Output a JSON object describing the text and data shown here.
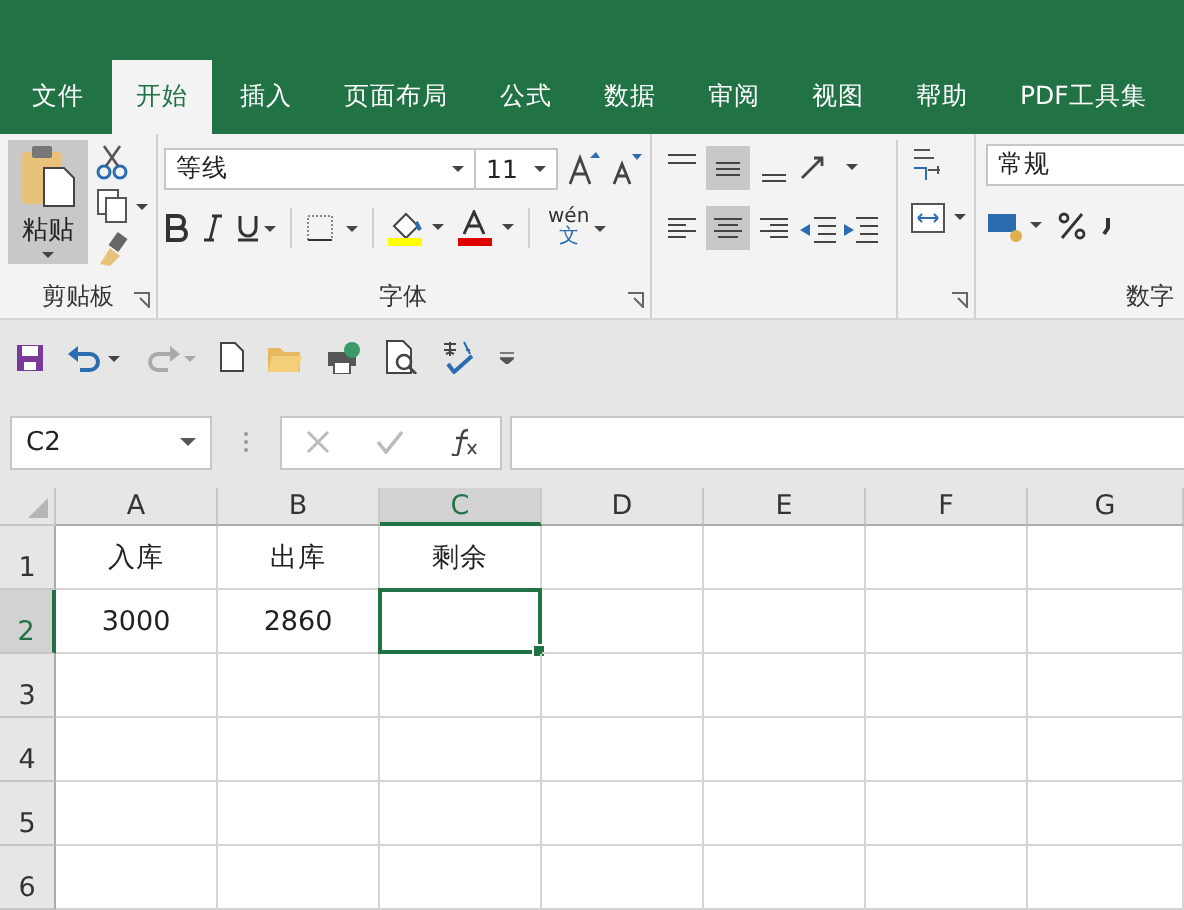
{
  "tabs": [
    {
      "label": "文件",
      "selected": false
    },
    {
      "label": "开始",
      "selected": true
    },
    {
      "label": "插入",
      "selected": false
    },
    {
      "label": "页面布局",
      "selected": false
    },
    {
      "label": "公式",
      "selected": false
    },
    {
      "label": "数据",
      "selected": false
    },
    {
      "label": "审阅",
      "selected": false
    },
    {
      "label": "视图",
      "selected": false
    },
    {
      "label": "帮助",
      "selected": false
    },
    {
      "label": "PDF工具集",
      "selected": false
    }
  ],
  "ribbon": {
    "clipboard": {
      "paste_label": "粘贴",
      "label": "剪贴板"
    },
    "font": {
      "name": "等线",
      "size": "11",
      "phonetic_label": "wén",
      "phonetic_glyph": "文",
      "label": "字体"
    },
    "alignment": {
      "top_row": [
        {
          "kind": "top",
          "selected": false
        },
        {
          "kind": "middle",
          "selected": true
        },
        {
          "kind": "bottom",
          "selected": false
        }
      ],
      "bottom_row": [
        {
          "kind": "left",
          "selected": false
        },
        {
          "kind": "center",
          "selected": true
        },
        {
          "kind": "right",
          "selected": false
        }
      ]
    },
    "number": {
      "format": "常规",
      "label": "数字"
    }
  },
  "formula_bar": {
    "name_box": "C2"
  },
  "sheet": {
    "columns": [
      {
        "label": "A",
        "selected": false
      },
      {
        "label": "B",
        "selected": false
      },
      {
        "label": "C",
        "selected": true
      },
      {
        "label": "D",
        "selected": false
      },
      {
        "label": "E",
        "selected": false
      },
      {
        "label": "F",
        "selected": false
      },
      {
        "label": "G",
        "selected": false
      }
    ],
    "rows": [
      {
        "label": "1",
        "selected": false,
        "cells": [
          "入库",
          "出库",
          "剩余"
        ]
      },
      {
        "label": "2",
        "selected": true,
        "cells": [
          "3000",
          "2860"
        ]
      },
      {
        "label": "3",
        "selected": false
      },
      {
        "label": "4",
        "selected": false
      },
      {
        "label": "5",
        "selected": false
      },
      {
        "label": "6",
        "selected": false
      }
    ]
  }
}
